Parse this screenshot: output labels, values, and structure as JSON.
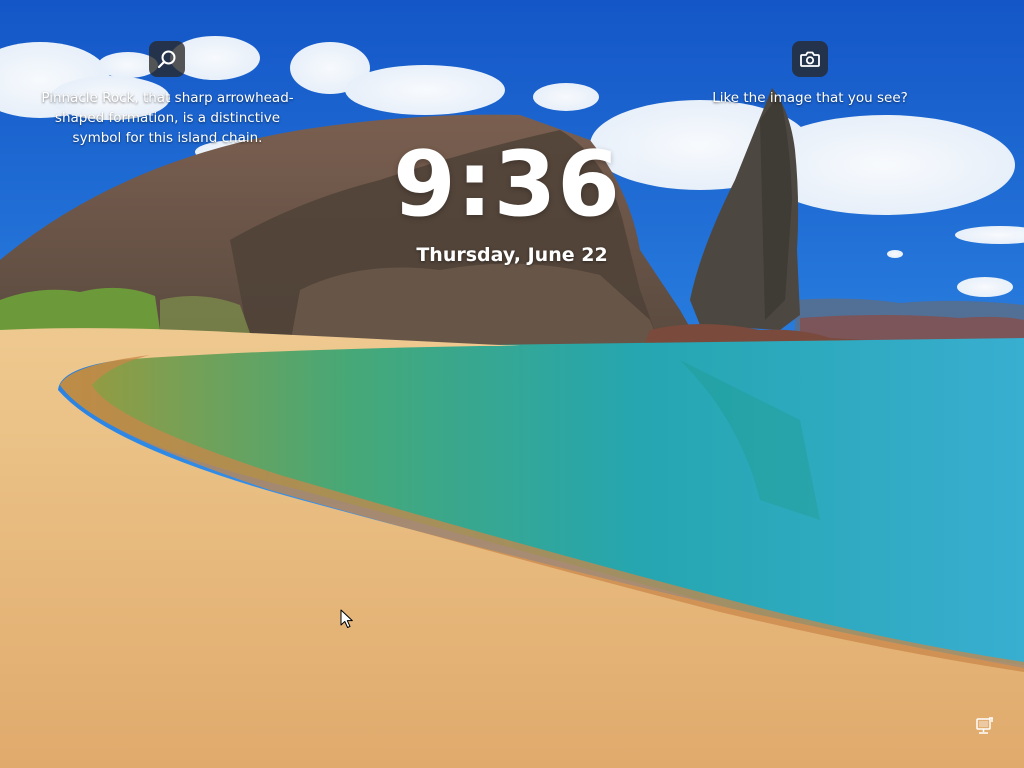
{
  "lockscreen": {
    "time": "9:36",
    "date": "Thursday, June 22",
    "image_info_lines": [
      "Pinnacle Rock, that sharp arrowhead-",
      "shaped formation, is a distinctive",
      "symbol for this island chain."
    ],
    "like_prompt": "Like the image that you see?"
  },
  "icons": {
    "search": "search-icon",
    "camera": "camera-icon",
    "network": "network-icon",
    "cursor": "mouse-pointer"
  },
  "colors": {
    "sky": "#1e6fd8",
    "sand": "#e7b77a",
    "water": "#2aa7c4",
    "rock": "#6b584b",
    "icon_bg": "#282828"
  }
}
